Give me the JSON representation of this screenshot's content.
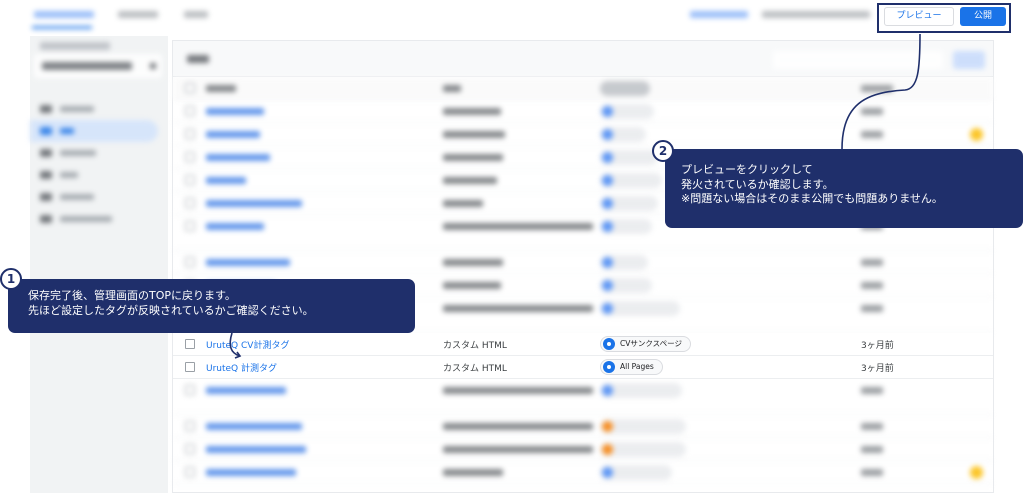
{
  "toolbar": {
    "preview_label": "プレビュー",
    "publish_label": "公開"
  },
  "tags_table": {
    "rows": [
      {
        "name": "UruteQ CV計測タグ",
        "type": "カスタム HTML",
        "trigger": "CVサンクスページ",
        "updated": "3ヶ月前"
      },
      {
        "name": "UruteQ 計測タグ",
        "type": "カスタム HTML",
        "trigger": "All Pages",
        "updated": "3ヶ月前"
      }
    ]
  },
  "callouts": [
    {
      "number": "1",
      "lines": [
        "保存完了後、管理画面のTOPに戻ります。",
        "先ほど設定したタグが反映されているかご確認ください。"
      ]
    },
    {
      "number": "2",
      "lines": [
        "プレビューをクリックして",
        "発火されているか確認します。",
        "※問題ない場合はそのまま公開でも問題ありません。"
      ]
    }
  ],
  "colors": {
    "accent": "#1a73e8",
    "callout": "#1f2f6b",
    "trigger_icon": "#4285f4",
    "trigger_icon_alt": "#f57c00",
    "star": "#fbbc04"
  }
}
